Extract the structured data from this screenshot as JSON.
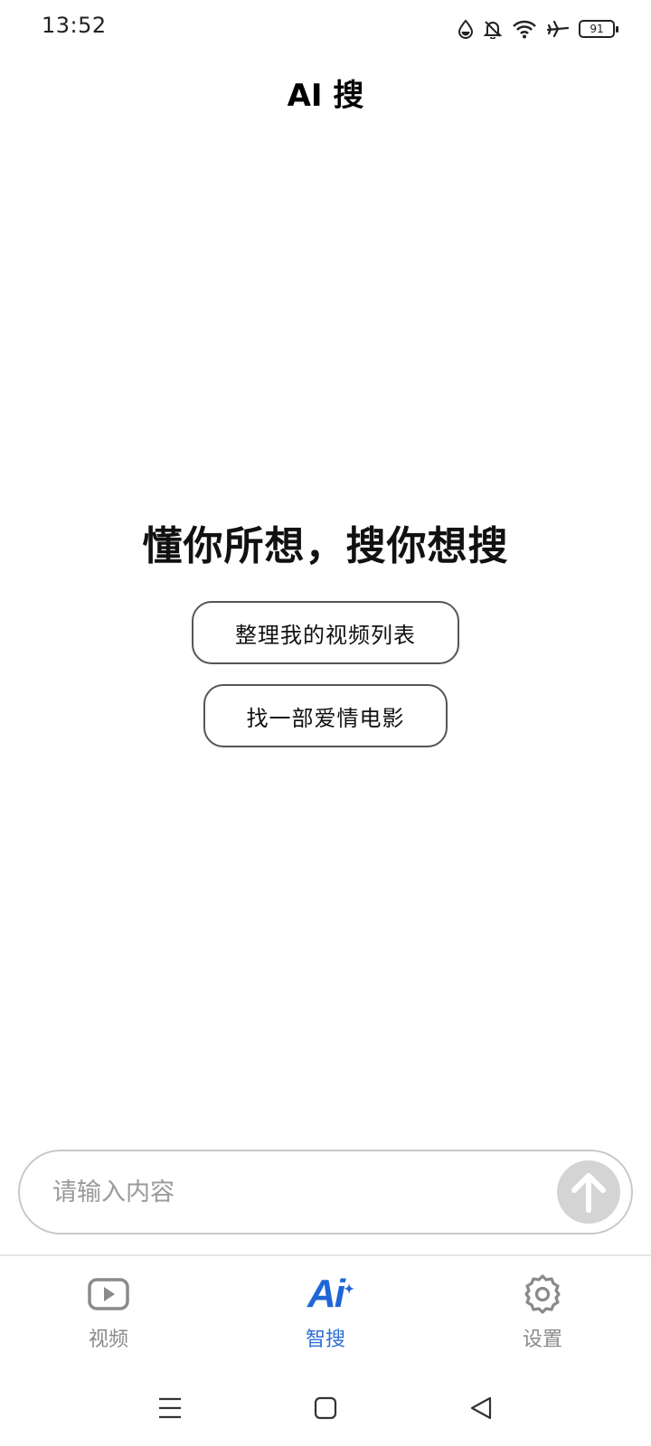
{
  "status_bar": {
    "time": "13:52",
    "battery_level": "91",
    "icons": [
      "water-drop-icon",
      "bell-off-icon",
      "wifi-icon",
      "airplane-mode-icon",
      "battery-icon"
    ]
  },
  "header": {
    "title": "AI 搜"
  },
  "main": {
    "hero_title": "懂你所想，搜你想搜",
    "suggestions": [
      {
        "label": "整理我的视频列表"
      },
      {
        "label": "找一部爱情电影"
      }
    ]
  },
  "input": {
    "placeholder": "请输入内容",
    "value": "",
    "send_icon": "arrow-up-icon"
  },
  "tab_bar": {
    "tabs": [
      {
        "label": "视频",
        "icon": "video-play-icon",
        "active": false
      },
      {
        "label": "智搜",
        "icon": "ai-icon",
        "glyph": "Ai",
        "active": true
      },
      {
        "label": "设置",
        "icon": "gear-icon",
        "active": false
      }
    ],
    "active_color": "#1f66d6",
    "inactive_color": "#8a8a8a"
  },
  "nav_bar": {
    "buttons": [
      "menu-icon",
      "home-icon",
      "back-icon"
    ]
  }
}
